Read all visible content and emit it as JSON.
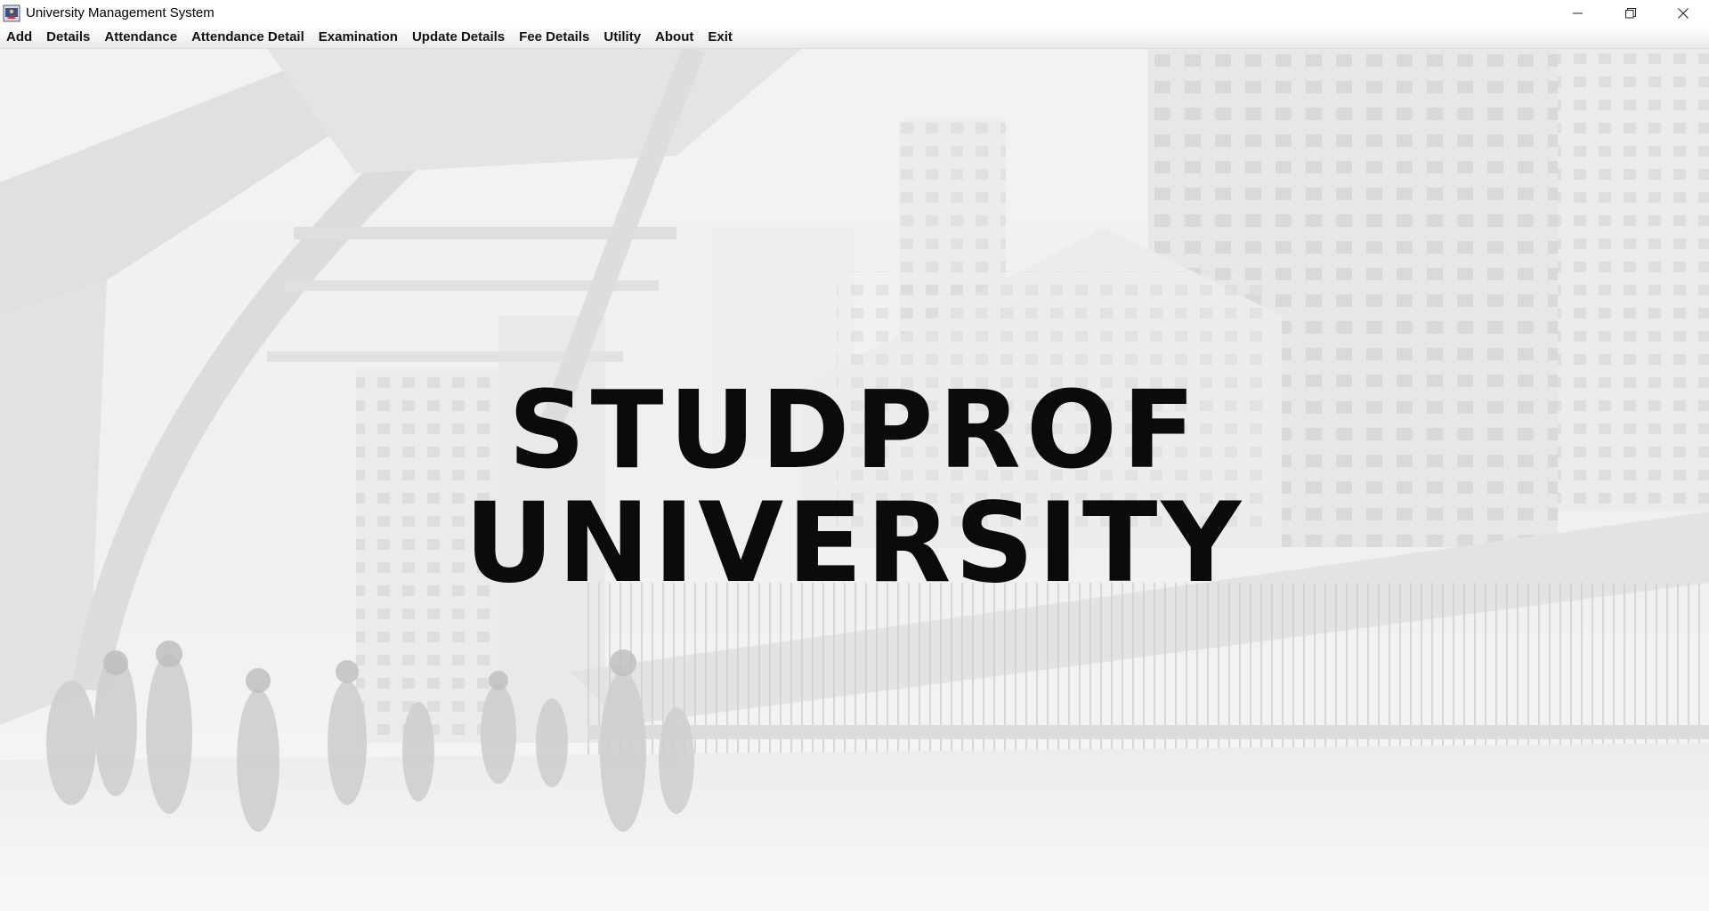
{
  "window": {
    "title": "University Management System"
  },
  "menu": {
    "items": [
      {
        "label": "Add"
      },
      {
        "label": "Details"
      },
      {
        "label": "Attendance"
      },
      {
        "label": "Attendance Detail"
      },
      {
        "label": "Examination"
      },
      {
        "label": "Update Details"
      },
      {
        "label": "Fee Details"
      },
      {
        "label": "Utility"
      },
      {
        "label": "About"
      },
      {
        "label": "Exit"
      }
    ]
  },
  "banner": {
    "line1": "STUDPROF",
    "line2": "UNIVERSITY"
  },
  "icons": {
    "app": "java-app-icon",
    "minimize": "minimize-icon",
    "restore": "restore-icon",
    "close": "close-icon"
  },
  "colors": {
    "headline": "#0b0b0b",
    "background": "#f4f4f4"
  }
}
